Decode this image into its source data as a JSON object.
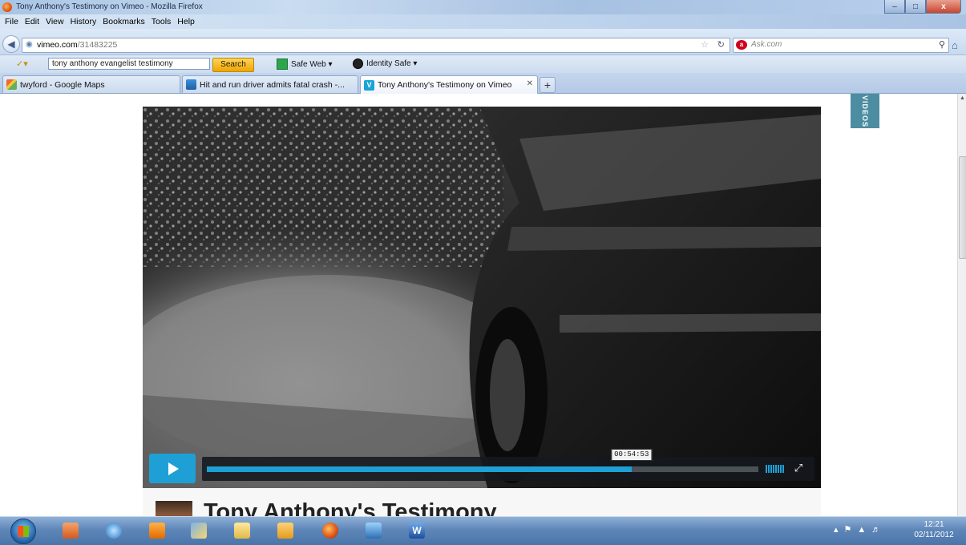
{
  "window": {
    "title": "Tony Anthony's Testimony on Vimeo - Mozilla Firefox",
    "minimize": "–",
    "maximize": "□",
    "close": "x"
  },
  "menu": [
    "File",
    "Edit",
    "View",
    "History",
    "Bookmarks",
    "Tools",
    "Help"
  ],
  "navigation": {
    "url_host": "vimeo.com",
    "url_path": "/31483225",
    "search_engine": "Ask.com"
  },
  "toolbar": {
    "search_value": "tony anthony evangelist testimony",
    "search_button": "Search",
    "safe_web": "Safe Web ▾",
    "identity_safe": "Identity Safe ▾"
  },
  "tabs": [
    {
      "label": "twyford - Google Maps",
      "icon": "maps-icon",
      "active": false
    },
    {
      "label": "Hit and run driver admits fatal crash -...",
      "icon": "news-icon",
      "active": false
    },
    {
      "label": "Tony Anthony's Testimony on Vimeo",
      "icon": "vimeo-icon",
      "active": true
    }
  ],
  "page": {
    "side_tab": "VIDEOS",
    "video_title": "Tony Anthony's Testimony",
    "player": {
      "timecode": "00:54:53",
      "progress": 0.77,
      "accent": "#1ea0d6"
    }
  },
  "taskbar": {
    "apps": [
      "outlook-icon",
      "ie-icon",
      "media-icon",
      "paint-icon",
      "explorer-icon",
      "photos-icon",
      "firefox-icon",
      "network-icon",
      "word-icon"
    ],
    "time": "12:21",
    "date": "02/11/2012"
  }
}
